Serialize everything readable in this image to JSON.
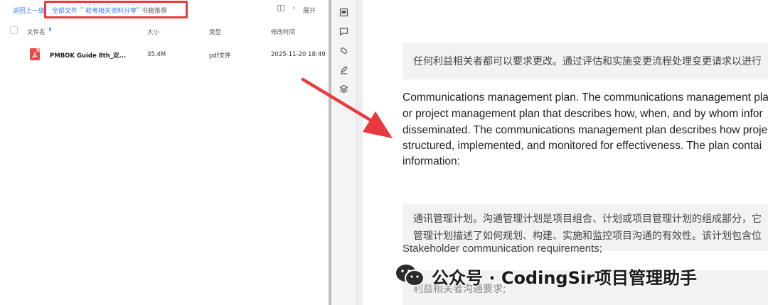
{
  "file_browser": {
    "back_label": "返回上一级",
    "breadcrumb": [
      "全部文件",
      "软考相关资料分享",
      "书籍推荐"
    ],
    "breadcrumb_sep": ">",
    "toolbar": {
      "grid_icon": "grid-icon",
      "back_icon": "‹",
      "expand_label": "展开"
    },
    "columns": {
      "name": "文件名",
      "size": "大小",
      "type": "类型",
      "modified": "修改时间"
    },
    "files": [
      {
        "name": "PMBOK Guide 8th_双...",
        "size": "35.4M",
        "type": "pdf文件",
        "modified": "2025-11-20 18:49",
        "icon": "pdf-icon"
      }
    ]
  },
  "tool_strip": {
    "icons": [
      "image-icon",
      "comment-icon",
      "attach-icon",
      "pen-icon",
      "layers-icon"
    ]
  },
  "document": {
    "quote1_zh": "任何利益相关者都可以要求更改。通过评估和实施变更流程处理变更请求以进行",
    "para_en": [
      "Communications management plan. The communications management pla",
      "or project management plan that describes how, when, and by whom infor",
      "disseminated. The communications management plan describes how proje",
      "structured, implemented, and monitored for effectiveness. The plan contai",
      "information:"
    ],
    "quote2_zh": [
      "通讯管理计划。沟通管理计划是项目组合、计划或项目管理计划的组成部分，它",
      "管理计划描述了如何规划、构建、实施和监控项目沟通的有效性。该计划包含位"
    ],
    "stakeholder_req": "Stakeholder communication requirements;",
    "quote3_zh": "利益相关者沟通要求;"
  },
  "watermark": {
    "text": "公众号 · CodingSir项目管理助手",
    "icon": "wechat-icon"
  },
  "colors": {
    "link_blue": "#3478f6",
    "highlight_red": "#e8393f",
    "pdf_red": "#e84a4a",
    "quote_bg": "#f2f2f2"
  }
}
